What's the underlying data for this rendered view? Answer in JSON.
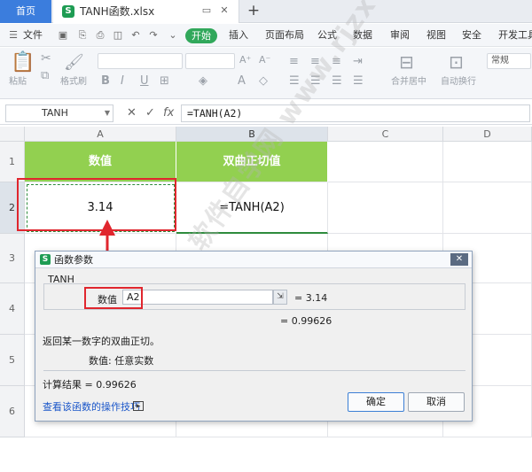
{
  "tabs": {
    "home_label": "首页",
    "file_name": "TANH函数.xlsx",
    "file_icon": "S",
    "new_tab": "+"
  },
  "menu": {
    "file_label": "文件",
    "start_label": "开始",
    "items": [
      "插入",
      "页面布局",
      "公式",
      "数据",
      "审阅",
      "视图",
      "安全",
      "开发工具"
    ]
  },
  "ribbon": {
    "paste_label": "粘贴",
    "format_painter_label": "格式刷",
    "merge_center_label": "合并居中",
    "wrap_label": "自动换行",
    "number_format": "常规"
  },
  "formula_bar": {
    "name_box": "TANH",
    "fx_label": "fx",
    "formula": "=TANH(A2)"
  },
  "grid": {
    "columns": [
      "A",
      "B",
      "C",
      "D"
    ],
    "rows": [
      "1",
      "2",
      "3",
      "4",
      "5",
      "6"
    ],
    "header_a": "数值",
    "header_b": "双曲正切值",
    "a2": "3.14",
    "b2": "=TANH(A2)",
    "header_color": "#92d050"
  },
  "dialog": {
    "title": "函数参数",
    "function_name": "TANH",
    "arg_label": "数值",
    "arg_value": "A2",
    "arg_result": "= 3.14",
    "fn_result": "= 0.99626",
    "description": "返回某一数字的双曲正切。",
    "param_help": "数值:  任意实数",
    "calc_result": "计算结果 = 0.99626",
    "help_link": "查看该函数的操作技巧",
    "ok_label": "确定",
    "cancel_label": "取消"
  },
  "watermark": "软件自学网 www.rjzxw.com",
  "accent_color": "#e0262e"
}
